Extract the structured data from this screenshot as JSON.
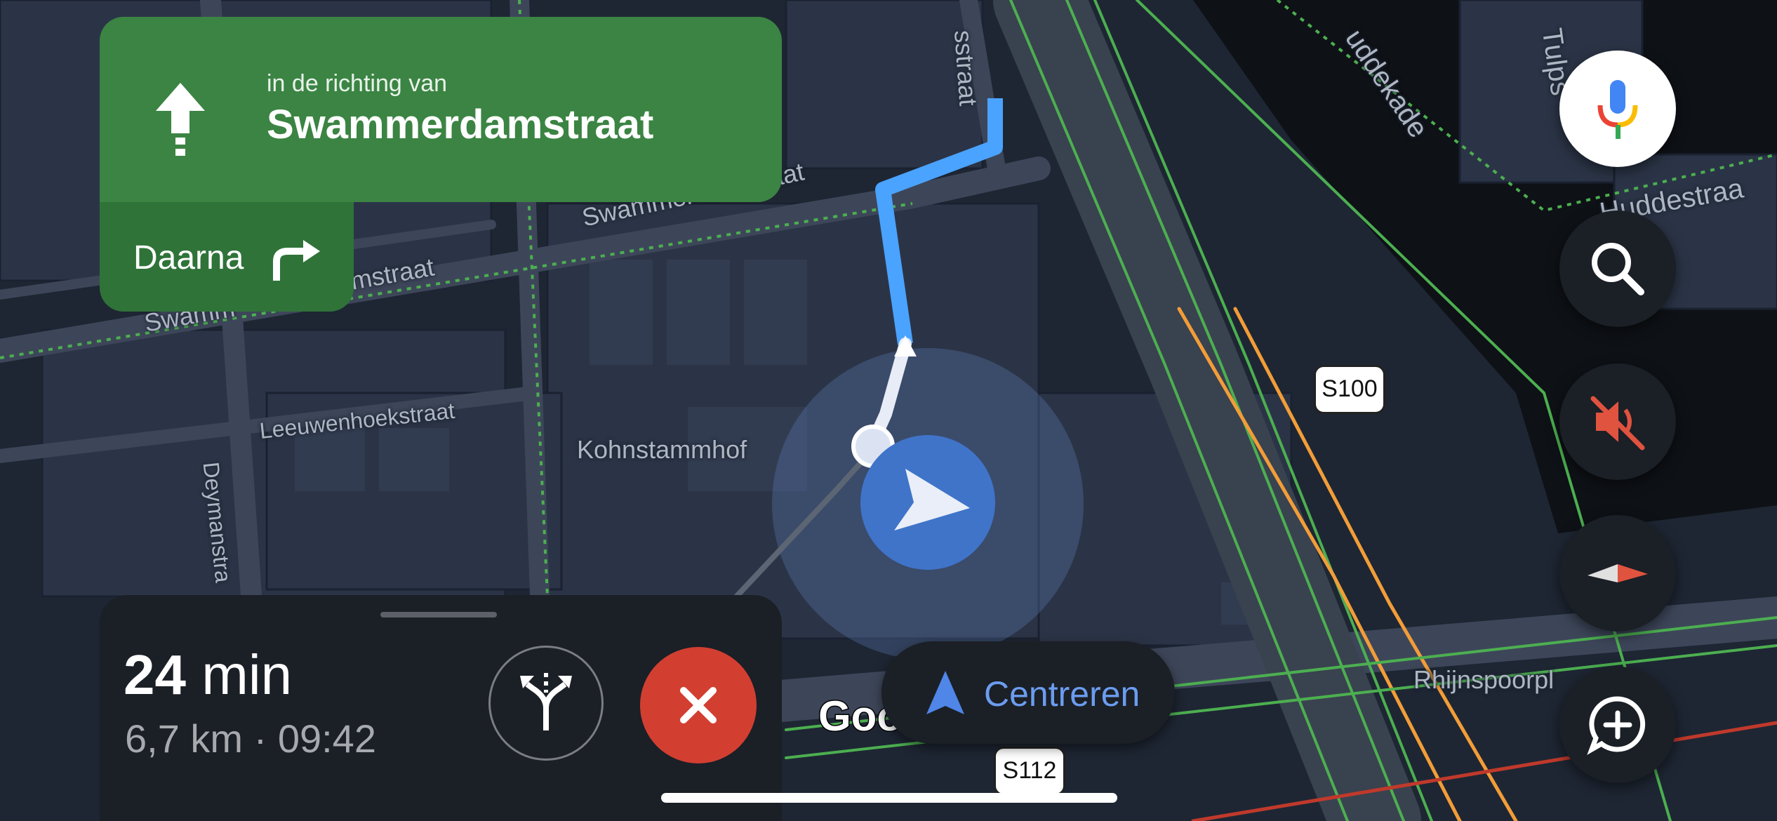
{
  "navigation": {
    "direction_prefix": "in de richting van",
    "street": "Swammerdamstraat",
    "then_label": "Daarna",
    "maneuver_icon": "straight-arrow-icon",
    "then_icon": "turn-right-icon"
  },
  "map": {
    "street_labels": [
      "Swammerdamstraat",
      "mstraat",
      "Swamm",
      "Leeuwenhoekstraat",
      "Deymanstra",
      "Kohnstammhof",
      "Rhijnspoorpl",
      "Huddestraa",
      "uddekade",
      "Tulps",
      "sstraat"
    ],
    "road_shields": [
      "S100",
      "S112"
    ],
    "brand": "Goo"
  },
  "controls": {
    "voice_icon": "microphone-icon",
    "search_icon": "search-icon",
    "mute_icon": "sound-off-icon",
    "compass_icon": "compass-icon",
    "report_icon": "add-report-icon"
  },
  "trip": {
    "duration_value": "24",
    "duration_unit": "min",
    "details": "6,7 km · 09:42",
    "alternatives_icon": "route-alternatives-icon",
    "close_icon": "close-icon"
  },
  "recenter": {
    "label": "Centreren",
    "icon": "navigation-arrow-icon"
  },
  "colors": {
    "maneuver_card": "#3b8443",
    "route": "#4aa3ff",
    "close_button": "#d23f31",
    "recenter_text": "#6b9df0",
    "traffic_free": "#4caf50",
    "traffic_slow": "#f29d38"
  }
}
